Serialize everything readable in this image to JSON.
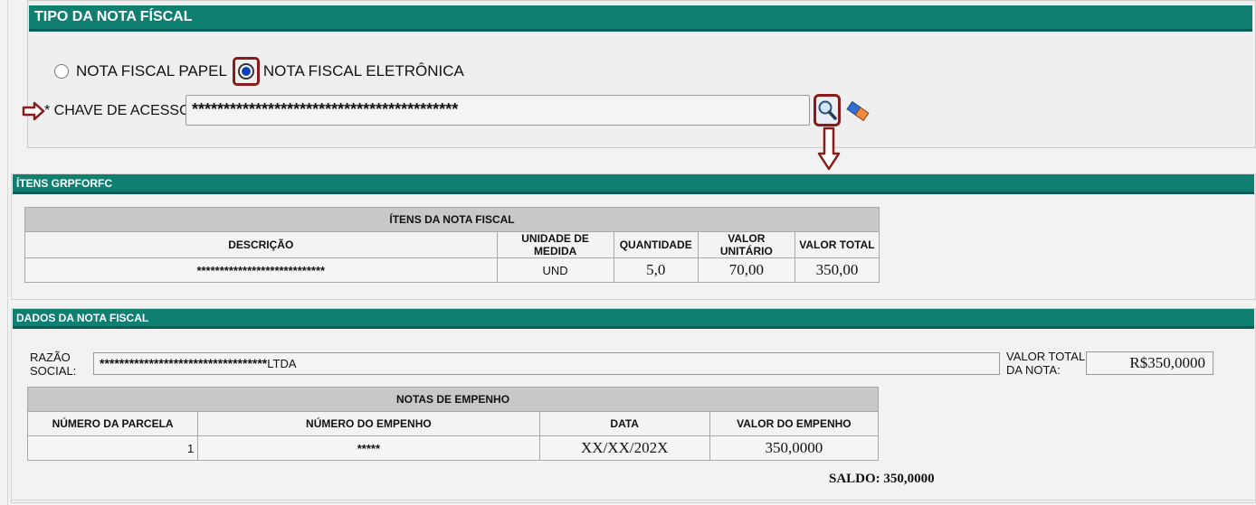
{
  "tipo_section": {
    "title": "TIPO DA NOTA FÍSCAL",
    "radio_papel_label": "NOTA FISCAL PAPEL",
    "radio_eletronica_label": "NOTA FISCAL ELETRÔNICA",
    "selected": "eletronica",
    "chave_label": "* CHAVE DE ACESSO:",
    "chave_value": "******************************************"
  },
  "itens_section": {
    "title": "ÍTENS GRPFORFC",
    "table_caption": "ÍTENS DA NOTA FISCAL",
    "columns": [
      "DESCRIÇÃO",
      "UNIDADE DE MEDIDA",
      "QUANTIDADE",
      "VALOR UNITÁRIO",
      "VALOR TOTAL"
    ],
    "rows": [
      {
        "descricao": "****************************",
        "unidade": "UND",
        "quantidade": "5,0",
        "valor_unitario": "70,00",
        "valor_total": "350,00"
      }
    ]
  },
  "dados_section": {
    "title": "DADOS DA NOTA FISCAL",
    "razao_label_1": "RAZÃO",
    "razao_label_2": "SOCIAL:",
    "razao_stars": "**********************************",
    "razao_suffix": "LTDA",
    "valor_total_label_1": "VALOR TOTAL",
    "valor_total_label_2": "DA NOTA:",
    "valor_total_value": "R$350,0000",
    "empenho_caption": "NOTAS DE EMPENHO",
    "empenho_columns": [
      "NÚMERO DA PARCELA",
      "NÚMERO DO EMPENHO",
      "DATA",
      "VALOR DO EMPENHO"
    ],
    "empenho_rows": [
      {
        "parcela": "1",
        "empenho": "*****",
        "data": "XX/XX/202X",
        "valor": "350,0000"
      }
    ],
    "saldo": "SALDO: 350,0000"
  },
  "colors": {
    "header_teal": "#0f7f72",
    "highlight_red": "#8b1a1a"
  },
  "icons": [
    "arrow-right-icon",
    "search-icon",
    "eraser-icon",
    "arrow-down-icon"
  ]
}
